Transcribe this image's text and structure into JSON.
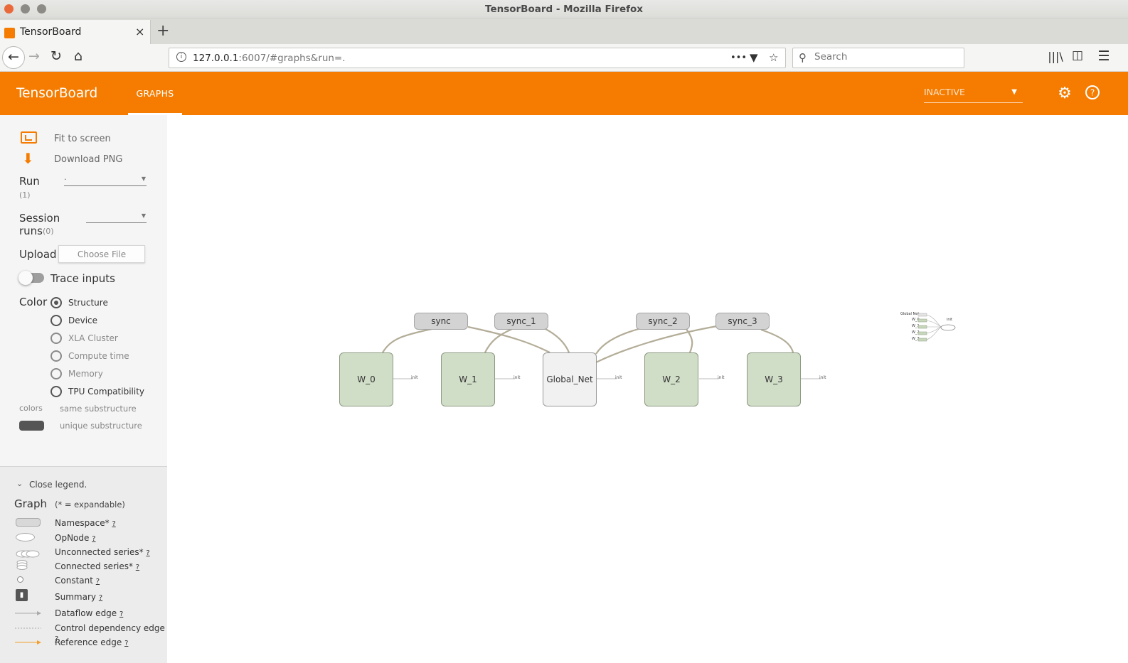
{
  "window": {
    "title": "TensorBoard - Mozilla Firefox"
  },
  "browser": {
    "tab_title": "TensorBoard",
    "tab_close": "×",
    "new_tab": "+",
    "url_host": "127.0.0.1",
    "url_rest": ":6007/#graphs&run=.",
    "url_actions": "•••",
    "search_placeholder": "Search"
  },
  "header": {
    "logo": "TensorBoard",
    "tab": "GRAPHS",
    "status": "INACTIVE",
    "colors": {
      "brand": "#f57c00"
    }
  },
  "sidebar": {
    "fit_to_screen": "Fit to screen",
    "download_png": "Download PNG",
    "run_label": "Run",
    "run_count": "(1)",
    "run_value": ".",
    "session_label_1": "Session",
    "session_label_2": "runs",
    "session_count": "(0)",
    "upload_label": "Upload",
    "choose_file": "Choose File",
    "trace_inputs": "Trace inputs",
    "color_label": "Color",
    "color_options": [
      "Structure",
      "Device",
      "XLA Cluster",
      "Compute time",
      "Memory",
      "TPU Compatibility"
    ],
    "color_selected": "Structure",
    "colors_caption": "colors",
    "same_substructure": "same substructure",
    "unique_substructure": "unique substructure"
  },
  "legend": {
    "toggle": "Close legend.",
    "title": "Graph",
    "subtitle": "(* = expandable)",
    "help": "?",
    "items": [
      "Namespace*",
      "OpNode",
      "Unconnected series*",
      "Connected series*",
      "Constant",
      "Summary",
      "Dataflow edge",
      "Control dependency edge",
      "Reference edge"
    ]
  },
  "graph": {
    "nodes": [
      "W_0",
      "W_1",
      "Global_Net",
      "W_2",
      "W_3"
    ],
    "sync_nodes": [
      "sync",
      "sync_1",
      "sync_2",
      "sync_3"
    ],
    "init_label": "init",
    "minimap_labels": [
      "Global Net",
      "W_0",
      "W_1",
      "W_2",
      "W_3"
    ]
  }
}
